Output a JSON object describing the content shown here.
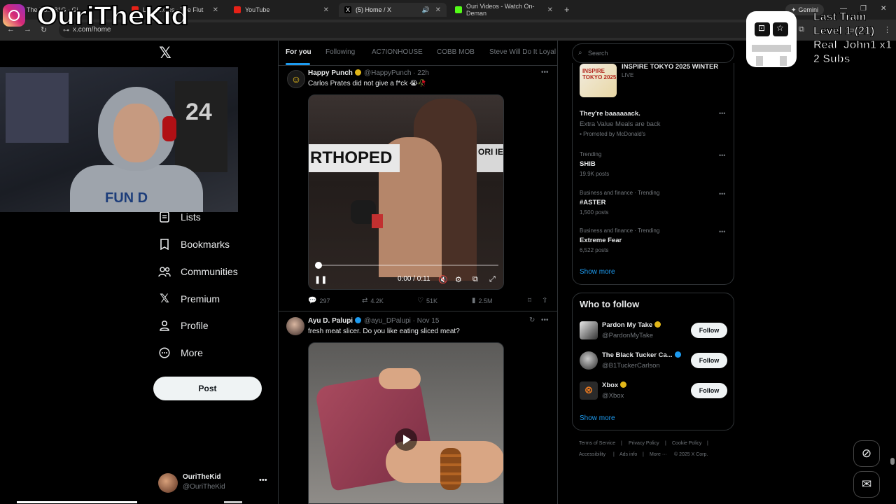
{
  "browser": {
    "tabs": [
      {
        "label": "The No...  81G - Gi...",
        "active": false
      },
      {
        "label": "LC... ...dies - The Flut",
        "active": false
      },
      {
        "label": "YouTube",
        "active": false
      },
      {
        "label": "(5) Home / X",
        "active": true
      },
      {
        "label": "Ouri Videos - Watch On-Deman",
        "active": false
      }
    ],
    "gemini_label": "Gemini",
    "url": "x.com/home"
  },
  "stream_overlay": {
    "streamer_name": "OuriTheKid",
    "webcam_jersey_number": "24",
    "hoodie_text": "FUN D",
    "game_lines": [
      "Last Train",
      "Level 1 (21)",
      "Real_John1 x1",
      "2 Subs"
    ]
  },
  "sidebar": {
    "items": [
      {
        "label": "Lists",
        "icon": "list-icon"
      },
      {
        "label": "Bookmarks",
        "icon": "bookmark-icon"
      },
      {
        "label": "Communities",
        "icon": "communities-icon"
      },
      {
        "label": "Premium",
        "icon": "x-logo-icon"
      },
      {
        "label": "Profile",
        "icon": "profile-icon"
      },
      {
        "label": "More",
        "icon": "more-circle-icon"
      }
    ],
    "post_label": "Post",
    "account": {
      "name": "OuriTheKid",
      "handle": "@OuriTheKid"
    }
  },
  "timeline": {
    "tabs": [
      "For you",
      "Following",
      "AC7IONHOUSE",
      "COBB MOB",
      "Steve Will Do It Loyal"
    ],
    "tweets": [
      {
        "name": "Happy Punch",
        "handle": "@HappyPunch",
        "time": "· 22h",
        "text": "Carlos Prates did not give a f*ck 😭🥀",
        "video": {
          "banner": "RTHOPED",
          "banner_right": "ORI IE",
          "time": "0:00 / 0:11",
          "progress": 0.02
        },
        "stats": {
          "replies": "297",
          "reposts": "4.2K",
          "likes": "51K",
          "views": "2.5M"
        }
      },
      {
        "name": "Ayu D. Palupi",
        "handle": "@ayu_DPalupi",
        "time": "· Nov 15",
        "text": "fresh meat slicer. Do you like eating sliced meat?"
      }
    ]
  },
  "right": {
    "search_placeholder": "Search",
    "event": {
      "title": "INSPIRE TOKYO 2025 WINTER",
      "sub": "LIVE",
      "thumb_text": "INSPIRE TOKYO 2025"
    },
    "promo": {
      "title": "They're baaaaaack.",
      "text": "Extra Value Meals are back",
      "promoted": "Promoted by McDonald's"
    },
    "trends": [
      {
        "context": "Trending",
        "title": "SHIB",
        "posts": "19.9K posts"
      },
      {
        "context": "Business and finance · Trending",
        "title": "#ASTER",
        "posts": "1,500 posts"
      },
      {
        "context": "Business and finance · Trending",
        "title": "Extreme Fear",
        "posts": "6,522 posts"
      }
    ],
    "show_more": "Show more",
    "who_to_follow": {
      "title": "Who to follow",
      "accounts": [
        {
          "name": "Pardon My Take",
          "handle": "@PardonMyTake",
          "badge": "gold"
        },
        {
          "name": "The Black Tucker Ca...",
          "handle": "@B1TuckerCarlson",
          "badge": "blue"
        },
        {
          "name": "Xbox",
          "handle": "@Xbox",
          "badge": "gold"
        }
      ],
      "follow_label": "Follow",
      "show_more": "Show more"
    },
    "footer": [
      "Terms of Service",
      "|",
      "Privacy Policy",
      "|",
      "Cookie Policy",
      "|",
      "Accessibility",
      "|",
      "Ads info",
      "|",
      "More ···",
      "© 2025 X Corp."
    ]
  }
}
